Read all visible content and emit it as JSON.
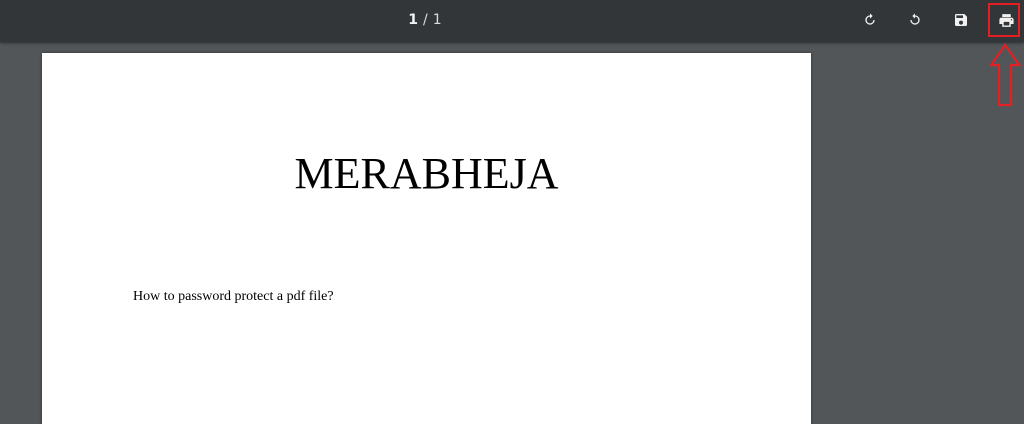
{
  "toolbar": {
    "current_page": "1",
    "separator": "/",
    "total_pages": "1",
    "buttons": [
      {
        "name": "rotate-clockwise",
        "icon": "rotate-cw-icon"
      },
      {
        "name": "rotate-counterclockwise",
        "icon": "rotate-ccw-icon"
      },
      {
        "name": "download",
        "icon": "save-icon"
      },
      {
        "name": "print",
        "icon": "print-icon"
      }
    ]
  },
  "annotation": {
    "highlight_color": "#e32124",
    "target": "print-button",
    "shape": "up-arrow"
  },
  "document": {
    "title": "MERABHEJA",
    "body": "How to password protect a pdf file?"
  },
  "colors": {
    "toolbar_bg": "#323639",
    "viewer_bg": "#525659",
    "page_bg": "#ffffff"
  }
}
